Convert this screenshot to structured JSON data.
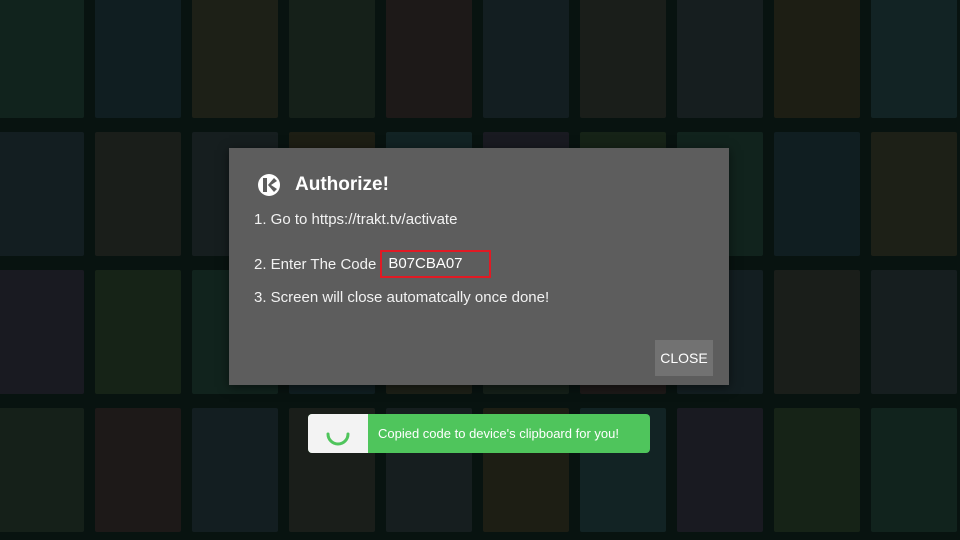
{
  "dialog": {
    "title": "Authorize!",
    "icon": "kodi-logo-icon",
    "step1": "1. Go to https://trakt.tv/activate",
    "step2_label": "2. Enter The Code",
    "code": "B07CBA07",
    "step3": "3. Screen will close automatcally once done!",
    "close_label": "CLOSE"
  },
  "toast": {
    "message": "Copied code to device's clipboard for you!",
    "icon": "loading-spinner-icon"
  },
  "colors": {
    "dialog_bg": "#5d5d5d",
    "code_highlight": "#e11a24",
    "toast_green": "#4fc55c",
    "background_dark": "#0d1714"
  }
}
